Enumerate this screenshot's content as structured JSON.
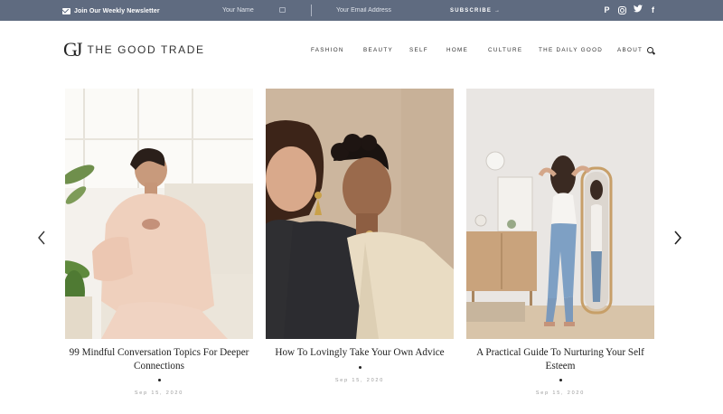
{
  "topbar": {
    "newsletter_label": "Join Our Weekly Newsletter",
    "name_placeholder": "Your Name",
    "email_placeholder": "Your Email Address",
    "subscribe_label": "SUBSCRIBE →",
    "social": [
      "pinterest",
      "instagram",
      "twitter",
      "facebook"
    ],
    "social_glyphs": {
      "pinterest": "P",
      "twitter": "t",
      "facebook": "f"
    }
  },
  "header": {
    "logo_mark": "GJ",
    "logo_text": "THE GOOD TRADE",
    "nav": [
      "FASHION",
      "BEAUTY",
      "SELF",
      "HOME",
      "CULTURE",
      "THE DAILY GOOD",
      "ABOUT"
    ]
  },
  "carousel": {
    "cards": [
      {
        "title": "99 Mindful Conversation Topics For Deeper Connections",
        "date": "Sep 15, 2020"
      },
      {
        "title": "How To Lovingly Take Your Own Advice",
        "date": "Sep 15, 2020"
      },
      {
        "title": "A Practical Guide To Nurturing Your Self Esteem",
        "date": "Sep 15, 2020"
      }
    ]
  },
  "colors": {
    "topbar_bg": "#5f6b80",
    "text": "#222222",
    "muted": "#999999"
  }
}
